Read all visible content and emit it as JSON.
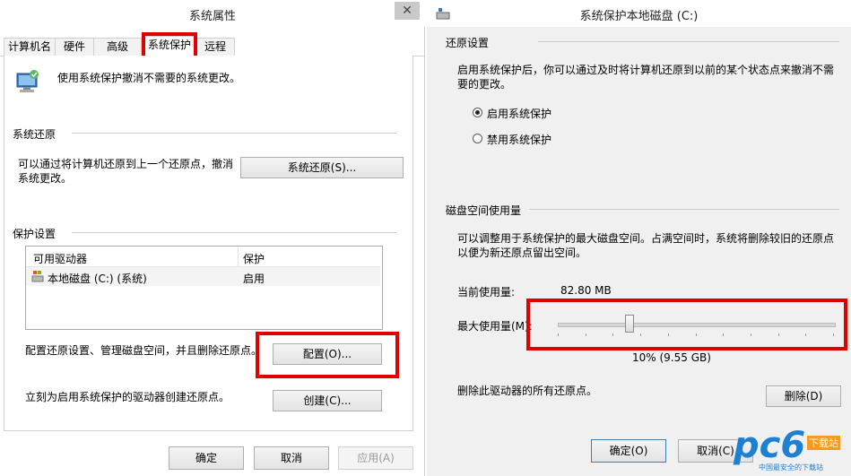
{
  "left": {
    "title": "系统属性",
    "close_glyph": "✕",
    "tabs": [
      {
        "label": "计算机名"
      },
      {
        "label": "硬件"
      },
      {
        "label": "高级"
      },
      {
        "label": "系统保护"
      },
      {
        "label": "远程"
      }
    ],
    "intro_text": "使用系统保护撤消不需要的系统更改。",
    "restore_section_title": "系统还原",
    "restore_desc_1": "可以通过将计算机还原到上一个还原点，撤消",
    "restore_desc_2": "系统更改。",
    "restore_button": "系统还原(S)...",
    "protect_section_title": "保护设置",
    "table": {
      "headers": [
        "可用驱动器",
        "保护"
      ],
      "rows": [
        [
          "本地磁盘 (C:) (系统)",
          "启用"
        ]
      ]
    },
    "config_desc": "配置还原设置、管理磁盘空间，并且删除还原点。",
    "config_button": "配置(O)...",
    "create_desc": "立刻为启用系统保护的驱动器创建还原点。",
    "create_button": "创建(C)...",
    "ok_button": "确定",
    "cancel_button": "取消",
    "apply_button": "应用(A)"
  },
  "right": {
    "title": "系统保护本地磁盘 (C:)",
    "restore_section_title": "还原设置",
    "restore_desc_1": "启用系统保护后，你可以通过及时将计算机还原到以前的某个状态点来撤消不需",
    "restore_desc_2": "要的更改。",
    "radio_on_label": "启用系统保护",
    "radio_off_label": "禁用系统保护",
    "disk_section_title": "磁盘空间使用量",
    "disk_desc_1": "可以调整用于系统保护的最大磁盘空间。占满空间时，系统将删除较旧的还原点",
    "disk_desc_2": "以便为新还原点留出空间。",
    "current_usage_label": "当前使用量:",
    "current_usage_value": "82.80 MB",
    "max_usage_label": "最大使用量(M):",
    "slider_level_fraction": 0.1,
    "max_usage_value": "10% (9.55 GB)",
    "delete_desc": "删除此驱动器的所有还原点。",
    "delete_button": "删除(D)",
    "ok_button": "确定(O)",
    "cancel_button": "取消(C)"
  },
  "watermark": {
    "brand": "pc6",
    "sub": "下载站",
    "tagline": "中国最安全的下载站"
  },
  "colors": {
    "highlight_red": "#e00000",
    "watermark_blue": "#1f7fd0"
  }
}
